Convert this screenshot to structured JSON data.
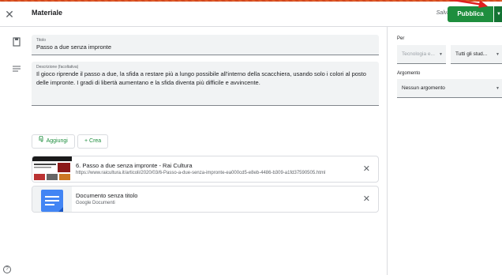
{
  "header": {
    "title": "Materiale",
    "saved": "Salvato",
    "publish": "Pubblica"
  },
  "form": {
    "title_label": "Titolo",
    "title_value": "Passo a due senza impronte",
    "desc_label": "Descrizione (facoltativa)",
    "desc_value": "Il gioco riprende il passo a due, la sfida a restare più a lungo possibile all'interno della scacchiera, usando solo i colori al posto delle impronte. I gradi di libertà aumentano e la sfida diventa più difficile e avvincente.",
    "add_label": "Aggiungi",
    "create_label": "+ Crea"
  },
  "attachments": [
    {
      "title": "6. Passo a due senza impronte - Rai Cultura",
      "subtitle": "https://www.raicultura.it/articoli/2020/03/6-Passo-a-due-senza-impronte-ea000cd5-e8eb-4486-b309-a1fd37590505.html"
    },
    {
      "title": "Documento senza titolo",
      "subtitle": "Google Documenti"
    }
  ],
  "side": {
    "for_label": "Per",
    "class_value": "Tecnologia e...",
    "students_value": "Tutti gli stud...",
    "topic_label": "Argomento",
    "topic_value": "Nessun argomento"
  },
  "colors": {
    "accent": "#1e8e3e",
    "docs_blue": "#4285f4"
  }
}
